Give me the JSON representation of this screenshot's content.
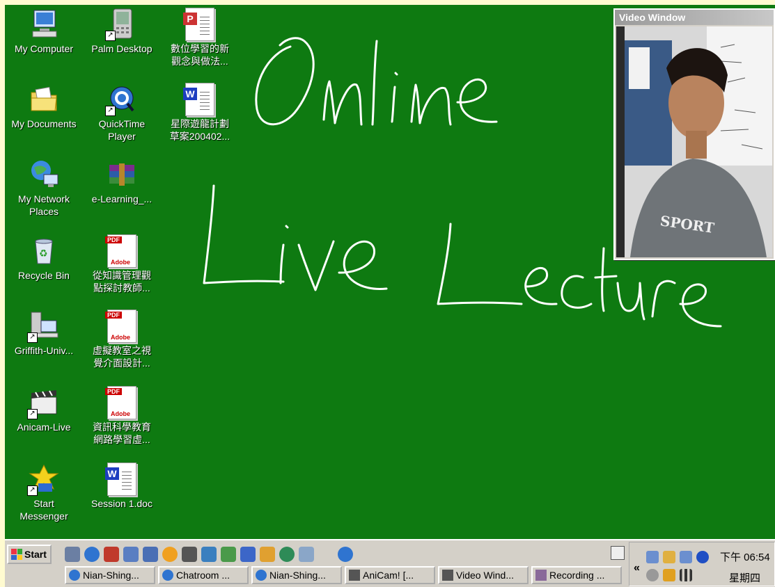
{
  "desktop": {
    "background": "#0e7a11",
    "icons": [
      {
        "label": "My Computer"
      },
      {
        "label": "Palm Desktop"
      },
      {
        "label": "數位學習的新\n觀念與做法..."
      },
      {
        "label": "My Documents"
      },
      {
        "label": "QuickTime\nPlayer"
      },
      {
        "label": "星際遊龍計劃\n草案200402..."
      },
      {
        "label": "My Network\nPlaces"
      },
      {
        "label": "e-Learning_..."
      },
      {
        "label": "Recycle Bin"
      },
      {
        "label": "從知識管理觀\n點探討教師..."
      },
      {
        "label": "Griffith-Univ..."
      },
      {
        "label": "虛擬教室之視\n覺介面設計..."
      },
      {
        "label": "Anicam-Live"
      },
      {
        "label": "資訊科學教育\n網路學習虛..."
      },
      {
        "label": "Start\nMessenger"
      },
      {
        "label": "Session 1.doc"
      }
    ],
    "handwriting": [
      "Online",
      "Live Lecture"
    ]
  },
  "video_window": {
    "title": "Video Window",
    "shirt_text": "SPORT"
  },
  "taskbar": {
    "start_label": "Start",
    "tasks": [
      {
        "label": "Nian-Shing..."
      },
      {
        "label": "Chatroom ..."
      },
      {
        "label": "Nian-Shing..."
      },
      {
        "label": "AniCam! [..."
      },
      {
        "label": "Video Wind..."
      },
      {
        "label": "Recording ..."
      }
    ],
    "tray_chevron": "«",
    "clock": "下午 06:54",
    "day": "星期四"
  },
  "colors": {
    "desktop": "#0e7a11",
    "taskbar": "#d4d0c8",
    "border": "#fffbd0"
  }
}
